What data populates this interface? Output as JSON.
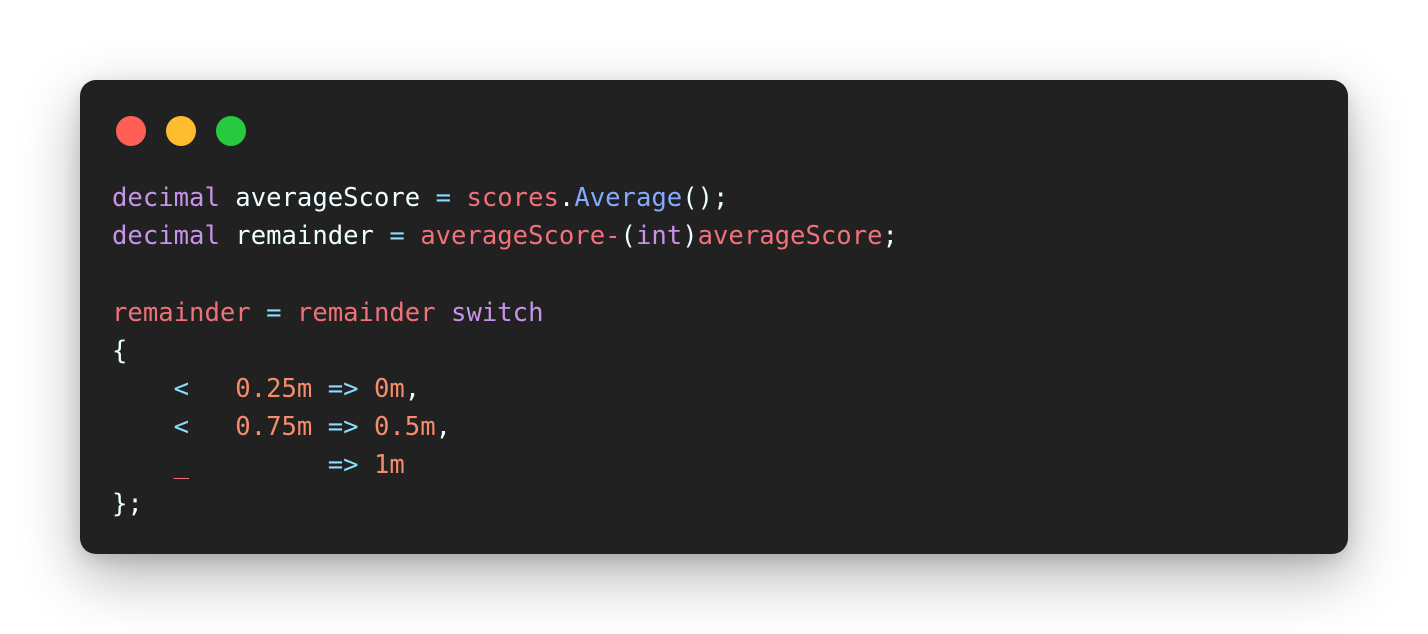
{
  "window": {
    "controls": [
      "close",
      "minimize",
      "maximize"
    ],
    "colors": {
      "close": "#ff5f56",
      "minimize": "#ffbd2e",
      "maximize": "#27c93f",
      "background": "#212121"
    }
  },
  "code": {
    "lines": [
      [
        {
          "t": "decimal",
          "c": "kw"
        },
        {
          "t": " averageScore ",
          "c": "plain"
        },
        {
          "t": "=",
          "c": "op"
        },
        {
          "t": " scores",
          "c": "var"
        },
        {
          "t": ".",
          "c": "plain"
        },
        {
          "t": "Average",
          "c": "fn"
        },
        {
          "t": "();",
          "c": "plain"
        }
      ],
      [
        {
          "t": "decimal",
          "c": "kw"
        },
        {
          "t": " remainder ",
          "c": "plain"
        },
        {
          "t": "=",
          "c": "op"
        },
        {
          "t": " averageScore-",
          "c": "var"
        },
        {
          "t": "(",
          "c": "plain"
        },
        {
          "t": "int",
          "c": "kw"
        },
        {
          "t": ")",
          "c": "plain"
        },
        {
          "t": "averageScore",
          "c": "var"
        },
        {
          "t": ";",
          "c": "plain"
        }
      ],
      [],
      [
        {
          "t": "remainder",
          "c": "var"
        },
        {
          "t": " = ",
          "c": "op"
        },
        {
          "t": "remainder",
          "c": "var"
        },
        {
          "t": " ",
          "c": "plain"
        },
        {
          "t": "switch",
          "c": "kw"
        }
      ],
      [
        {
          "t": "{",
          "c": "plain"
        }
      ],
      [
        {
          "t": "    <   ",
          "c": "op"
        },
        {
          "t": "0.25m",
          "c": "num"
        },
        {
          "t": " => ",
          "c": "op"
        },
        {
          "t": "0m",
          "c": "num"
        },
        {
          "t": ",",
          "c": "plain"
        }
      ],
      [
        {
          "t": "    <   ",
          "c": "op"
        },
        {
          "t": "0.75m",
          "c": "num"
        },
        {
          "t": " => ",
          "c": "op"
        },
        {
          "t": "0.5m",
          "c": "num"
        },
        {
          "t": ",",
          "c": "plain"
        }
      ],
      [
        {
          "t": "    ",
          "c": "plain"
        },
        {
          "t": "_",
          "c": "var"
        },
        {
          "t": "         => ",
          "c": "op"
        },
        {
          "t": "1m",
          "c": "num"
        }
      ],
      [
        {
          "t": "};",
          "c": "plain"
        }
      ]
    ]
  }
}
